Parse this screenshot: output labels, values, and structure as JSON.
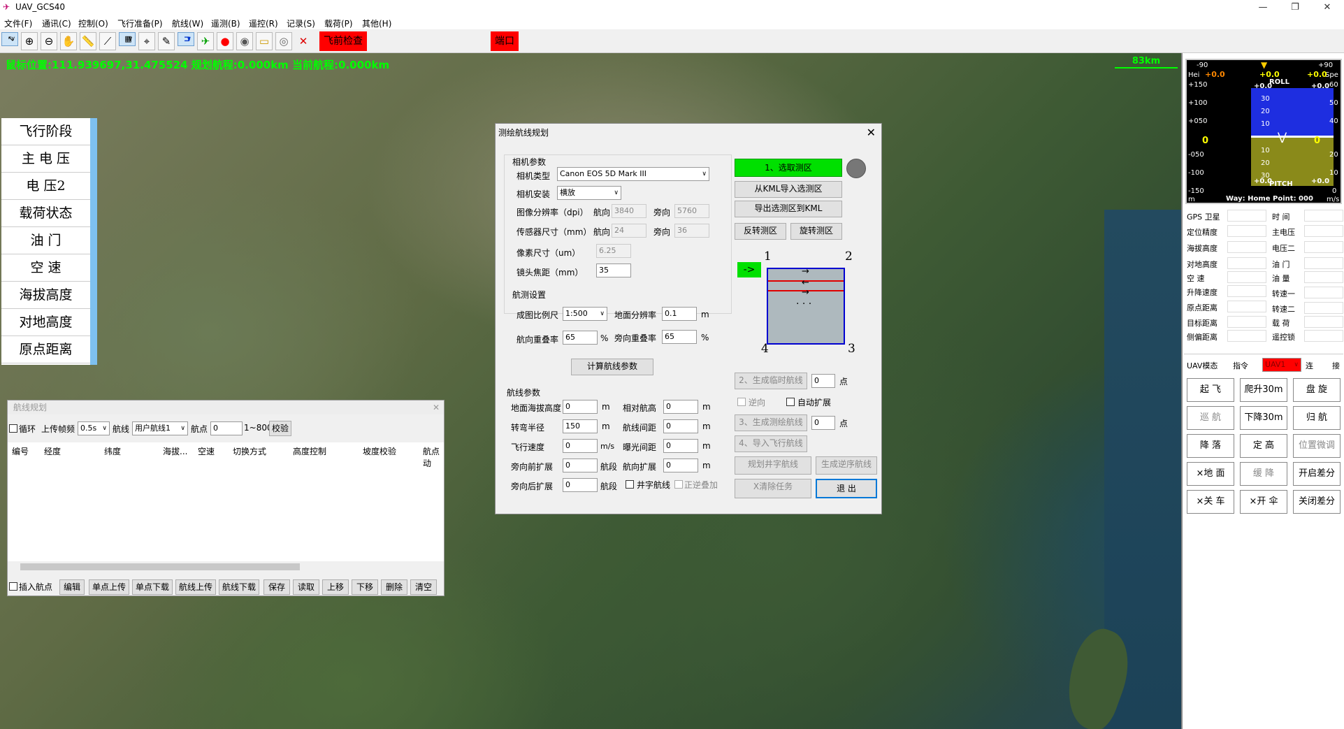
{
  "window": {
    "title": "UAV_GCS40",
    "controls": [
      "—",
      "❐",
      "✕"
    ]
  },
  "menu": [
    "文件(F)",
    "通讯(C)",
    "控制(O)",
    "飞行准备(P)",
    "航线(W)",
    "遥测(B)",
    "遥控(R)",
    "记录(S)",
    "载荷(P)",
    "其他(H)"
  ],
  "toolbar": {
    "icons": [
      "pointer-icon",
      "zoom-in-icon",
      "zoom-out-icon",
      "hand-icon",
      "ruler-icon",
      "draw-line-icon",
      "grid-icon",
      "crosshair-icon",
      "eraser-icon",
      "route-icon",
      "plane-icon",
      "record-icon",
      "camera-icon",
      "folder-icon",
      "disc-icon",
      "close-icon"
    ],
    "preflight_label": "飞前检查",
    "port_label": "端口"
  },
  "map": {
    "status_line": "鼠标位置:111.939697,31.475524  规划航程:0.000km  当前航程:0.000km",
    "scale": "83km"
  },
  "left_panel": [
    "飞行阶段",
    "主 电 压",
    "电    压2",
    "载荷状态",
    "油    门",
    "空    速",
    "海拔高度",
    "对地高度",
    "原点距离"
  ],
  "route_window": {
    "title": "航线规划",
    "loop_label": "循环",
    "upload_freq_label": "上传帧频",
    "upload_freq_value": "0.5s",
    "route_label": "航线",
    "route_value": "用户航线1",
    "waypoint_label": "航点",
    "waypoint_value": "0",
    "waypoint_range": "1~800",
    "verify_button": "校验",
    "columns": [
      "编号",
      "经度",
      "纬度",
      "海拔...",
      "空速",
      "切换方式",
      "高度控制",
      "坡度校验",
      "航点动"
    ],
    "insert_label": "插入航点",
    "buttons": [
      "编辑",
      "单点上传",
      "单点下载",
      "航线上传",
      "航线下载",
      "保存",
      "读取",
      "上移",
      "下移",
      "删除",
      "清空"
    ]
  },
  "survey": {
    "title": "测绘航线规划",
    "camera_group": "相机参数",
    "camera_type_label": "相机类型",
    "camera_type": "Canon EOS 5D Mark III",
    "mount_label": "相机安装",
    "mount_value": "横放",
    "resolution_label": "图像分辨率（dpi）",
    "along_label": "航向",
    "across_label": "旁向",
    "res_along": "3840",
    "res_across": "5760",
    "sensor_label": "传感器尺寸（mm）",
    "sensor_along": "24",
    "sensor_across": "36",
    "pixel_label": "像素尺寸（um）",
    "pixel_value": "6.25",
    "focal_label": "镜头焦距（mm）",
    "focal_value": "35",
    "aerial_group": "航测设置",
    "scale_label": "成图比例尺",
    "scale_value": "1:500",
    "gsd_label": "地面分辨率",
    "gsd_value": "0.1",
    "gsd_unit": "m",
    "fwd_overlap_label": "航向重叠率",
    "fwd_overlap_value": "65",
    "side_overlap_label": "旁向重叠率",
    "side_overlap_value": "65",
    "pct": "%",
    "calc_button": "计算航线参数",
    "route_group": "航线参数",
    "ground_alt_label": "地面海拔高度",
    "ground_alt": "0",
    "rel_alt_label": "相对航高",
    "rel_alt": "0",
    "turn_radius_label": "转弯半径",
    "turn_radius": "150",
    "line_spacing_label": "航线间距",
    "line_spacing": "0",
    "speed_label": "飞行速度",
    "speed": "0",
    "speed_unit": "m/s",
    "exposure_label": "曝光间距",
    "exposure": "0",
    "side_front_label": "旁向前扩展",
    "side_front": "0",
    "seg_unit": "航段",
    "fwd_ext_label": "航向扩展",
    "fwd_ext": "0",
    "side_back_label": "旁向后扩展",
    "side_back": "0",
    "cross_label": "井字航线",
    "reverse_stack_label": "正逆叠加",
    "m": "m",
    "step1": "1、选取测区",
    "import_kml": "从KML导入选测区",
    "export_kml": "导出选测区到KML",
    "reverse_area": "反转测区",
    "rotate_area": "旋转测区",
    "corners": [
      "1",
      "2",
      "3",
      "4"
    ],
    "dots": "· · ·",
    "step2": "2、生成临时航线",
    "step2_value": "0",
    "point_unit": "点",
    "reverse_dir": "逆向",
    "auto_expand": "自动扩展",
    "step3": "3、生成测绘航线",
    "step3_value": "0",
    "step4": "4、导入飞行航线",
    "plan_cross": "规划井字航线",
    "gen_reverse": "生成逆序航线",
    "clear_task": "X清除任务",
    "exit": "退  出"
  },
  "hud": {
    "top_scale_left": "-90",
    "top_scale_right": "+90",
    "hei": "Hei",
    "spe": "Spe",
    "yaw_left": "+0.0",
    "yaw_center": "+0.0",
    "yaw_right": "+0.0",
    "roll": "ROLL",
    "pitch": "PITCH",
    "alt_scale": [
      "+150",
      "+100",
      "+050",
      "0",
      "-050",
      "-100",
      "-150"
    ],
    "spd_scale": [
      "60",
      "50",
      "40",
      "30",
      "20",
      "10",
      "0"
    ],
    "pitch_scale": [
      "30",
      "20",
      "10",
      "10",
      "20",
      "30"
    ],
    "left_zero": "0",
    "right_zero": "0",
    "roll_top_l": "+0.0",
    "roll_top_r": "+0.0",
    "pitch_bot_l": "+0.0",
    "pitch_bot_r": "+0.0",
    "m_left": "m",
    "ms_right": "m/s",
    "way_text": "Way: Home Point: 000"
  },
  "telemetry": {
    "left": [
      "GPS 卫星",
      "定位精度",
      "海拔高度",
      "对地高度",
      "空    速",
      "升降速度",
      "原点距离",
      "目标距离",
      "侧偏距离"
    ],
    "right": [
      "时    间",
      "主电压",
      "电压二",
      "油    门",
      "油    量",
      "转速一",
      "转速二",
      "载    荷",
      "遥控锁"
    ]
  },
  "command": {
    "mode_label": "UAV模态",
    "cmd_label": "指令",
    "uav_value": "UAV1",
    "connect": "连",
    "link": "接",
    "buttons": [
      [
        "起    飞",
        "爬升30m",
        "盘    旋"
      ],
      [
        "巡    航",
        "下降30m",
        "归    航"
      ],
      [
        "降    落",
        "定    高",
        "位置微调"
      ],
      [
        "×地    面",
        "缓    降",
        "开启差分"
      ],
      [
        "×关    车",
        "×开    伞",
        "关闭差分"
      ]
    ]
  },
  "colors": {
    "status_green": "#00ff00",
    "alert_red": "#ff0000",
    "step_green": "#00e000",
    "hud_sky": "#1e2ee0",
    "hud_ground": "#8a8a1a"
  }
}
